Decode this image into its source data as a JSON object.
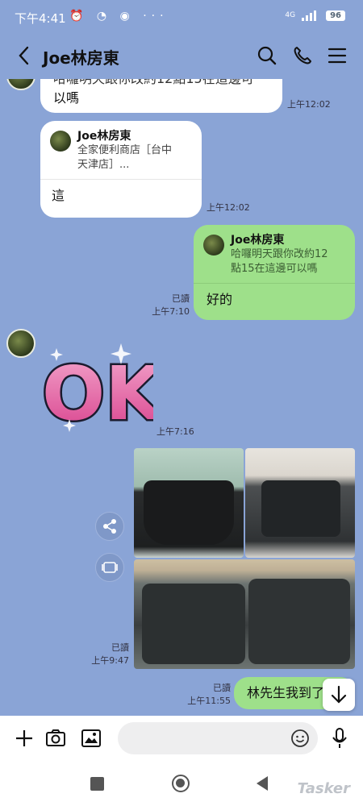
{
  "status_bar": {
    "time": "下午4:41",
    "network": "4G",
    "battery": "96"
  },
  "header": {
    "title": "Joe林房東"
  },
  "messages": {
    "m1": {
      "text": "以嗎",
      "partial_top": "哈囉明天跟你改約12點15在這邊可",
      "time": "上午12:02"
    },
    "m2": {
      "quote_name": "Joe林房東",
      "quote_line1": "全家便利商店［台中",
      "quote_line2": "天津店］...",
      "text": "這",
      "time": "上午12:02"
    },
    "m3": {
      "quote_name": "Joe林房東",
      "quote_line1": "哈囉明天跟你改約12",
      "quote_line2": "點15在這邊可以嗎",
      "text": "好的",
      "read": "已讀",
      "time": "上午7:10"
    },
    "m4": {
      "sticker_text": "OK!",
      "time": "上午7:16"
    },
    "m5": {
      "read": "已讀",
      "time": "上午9:47"
    },
    "m6": {
      "text": "林先生我到了",
      "read": "已讀",
      "time": "上午11:55"
    }
  },
  "watermark": "Tasker",
  "colors": {
    "chat_bg": "#8aa4d6",
    "sent_bubble": "#9ee08a",
    "received_bubble": "#ffffff",
    "sticker_pink": "#e0579b"
  },
  "icons": [
    "back-arrow-icon",
    "search-icon",
    "phone-icon",
    "menu-icon",
    "share-icon",
    "video-icon",
    "arrow-down-icon",
    "plus-icon",
    "camera-icon",
    "image-icon",
    "emoji-icon",
    "mic-icon"
  ]
}
